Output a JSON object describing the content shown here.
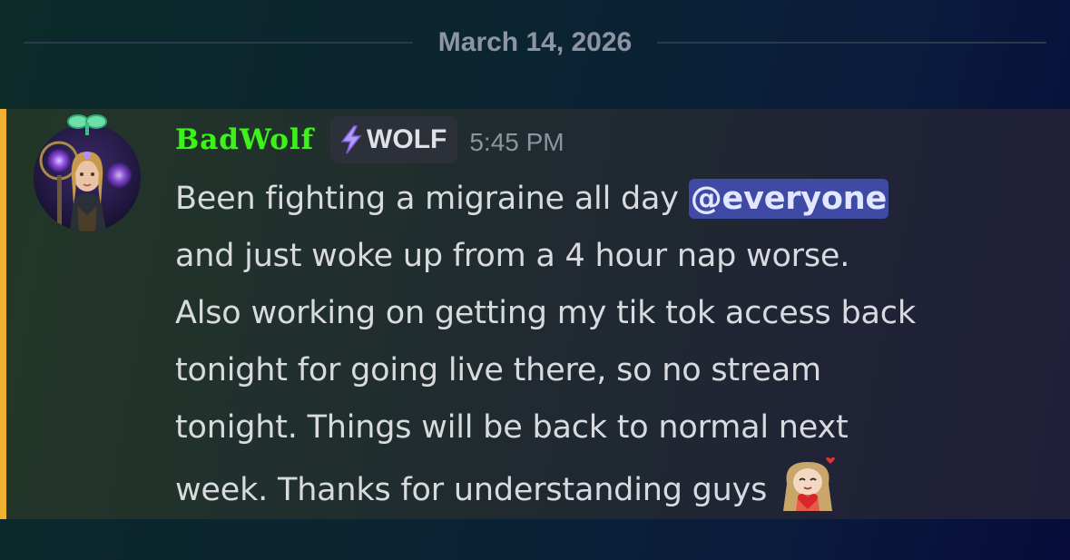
{
  "date_divider": {
    "label": "March 14, 2026"
  },
  "message": {
    "author": {
      "username": "BadWolf",
      "username_color": "#3ef21c",
      "avatar": "avatar-fantasy-woman",
      "avatar_decoration": "sprout-icon"
    },
    "tag": {
      "icon": "lightning-bolt-icon",
      "label": "WOLF"
    },
    "timestamp": "5:45 PM",
    "mention_highlight_color": "#f0b132",
    "lines": [
      {
        "before": "Been fighting a migraine all day ",
        "mention": "@everyone"
      },
      {
        "text": "and just woke up from a 4 hour nap worse."
      },
      {
        "text": "Also working on getting my tik tok access back"
      },
      {
        "text": "tonight for going live there, so no stream"
      },
      {
        "text": "tonight. Things will be back to normal next"
      },
      {
        "text": "week. Thanks for understanding guys",
        "emoji": "heart-hug-emoji"
      }
    ]
  }
}
